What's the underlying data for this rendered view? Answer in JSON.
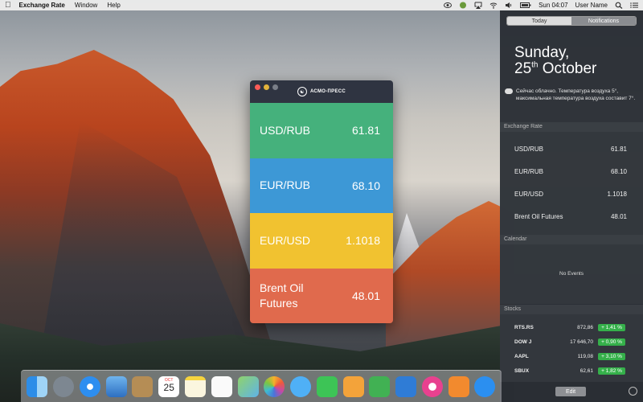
{
  "menubar": {
    "app_name": "Exchange Rate",
    "menus": [
      "Window",
      "Help"
    ],
    "clock": "Sun 04:07",
    "user": "User Name"
  },
  "app": {
    "logo_text": "АСМО-ПРЕСС",
    "rates": [
      {
        "pair": "USD/RUB",
        "value": "61.81",
        "color": "#45b17c"
      },
      {
        "pair": "EUR/RUB",
        "value": "68.10",
        "color": "#3d98d6"
      },
      {
        "pair": "EUR/USD",
        "value": "1.1018",
        "color": "#f1c230"
      },
      {
        "pair": "Brent Oil Futures",
        "value": "48.01",
        "color": "#e06a4d"
      }
    ]
  },
  "notification_center": {
    "tabs": [
      {
        "label": "Today",
        "active": true
      },
      {
        "label": "Notifications",
        "active": false
      }
    ],
    "day": "Sunday,",
    "date_num": "25",
    "date_suffix": "th",
    "date_month": "October",
    "weather": "Сейчас облачно. Температура воздуха 5°, максимальная температура воздуха составит 7°.",
    "exchange_title": "Exchange Rate",
    "exchange_rows": [
      {
        "pair": "USD/RUB",
        "value": "61.81"
      },
      {
        "pair": "EUR/RUB",
        "value": "68.10"
      },
      {
        "pair": "EUR/USD",
        "value": "1.1018"
      },
      {
        "pair": "Brent Oil Futures",
        "value": "48.01"
      }
    ],
    "calendar_title": "Calendar",
    "calendar_empty": "No Events",
    "stocks_title": "Stocks",
    "stocks": [
      {
        "symbol": "RTS.RS",
        "price": "872,86",
        "change": "+ 1,41 %"
      },
      {
        "symbol": "DOW J",
        "price": "17 646,70",
        "change": "+ 0,90 %"
      },
      {
        "symbol": "AAPL",
        "price": "119,08",
        "change": "+ 3,10 %"
      },
      {
        "symbol": "SBUX",
        "price": "62,61",
        "change": "+ 1,82 %"
      }
    ],
    "edit_label": "Edit"
  },
  "dock": {
    "calendar_month": "OCT",
    "calendar_day": "25",
    "items": [
      "finder-icon",
      "launchpad-icon",
      "safari-icon",
      "mail-icon",
      "contacts-icon",
      "calendar-icon",
      "notes-icon",
      "reminders-icon",
      "maps-icon",
      "photos-icon",
      "messages-icon",
      "facetime-icon",
      "pages-icon",
      "numbers-icon",
      "keynote-icon",
      "itunes-icon",
      "ibooks-icon",
      "app-store-icon"
    ]
  }
}
